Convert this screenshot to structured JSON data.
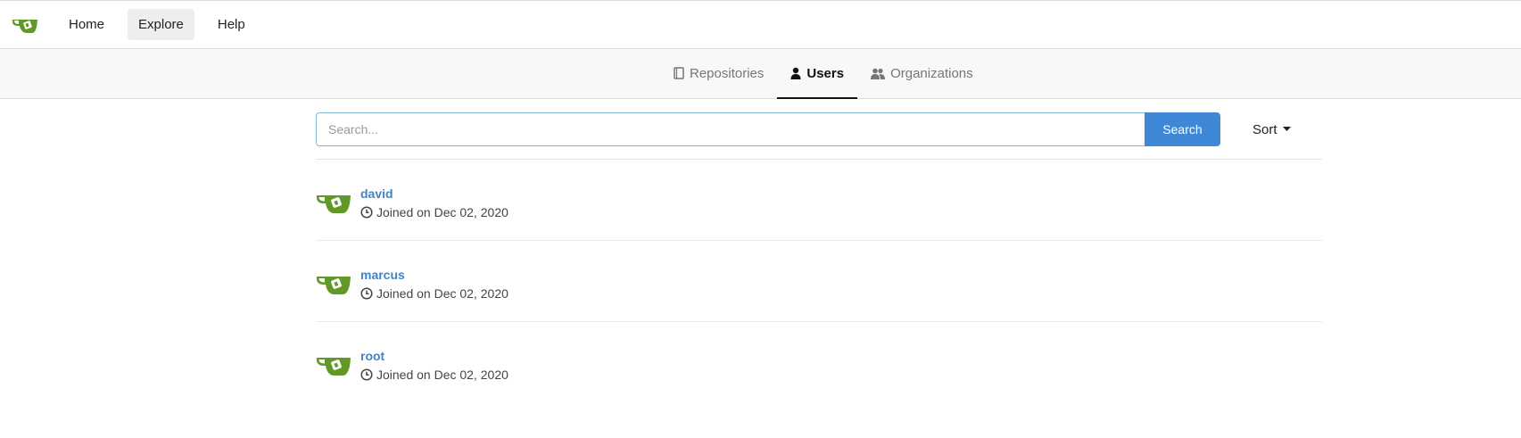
{
  "nav": {
    "logo_icon": "gitea-teacup-icon",
    "items": [
      {
        "label": "Home",
        "active": false
      },
      {
        "label": "Explore",
        "active": true
      },
      {
        "label": "Help",
        "active": false
      }
    ]
  },
  "tabs": [
    {
      "label": "Repositories",
      "icon": "book-icon",
      "active": false
    },
    {
      "label": "Users",
      "icon": "person-icon",
      "active": true
    },
    {
      "label": "Organizations",
      "icon": "people-icon",
      "active": false
    }
  ],
  "search": {
    "placeholder": "Search...",
    "value": "",
    "button_label": "Search",
    "sort_label": "Sort"
  },
  "users": [
    {
      "name": "david",
      "joined": "Joined on Dec 02, 2020"
    },
    {
      "name": "marcus",
      "joined": "Joined on Dec 02, 2020"
    },
    {
      "name": "root",
      "joined": "Joined on Dec 02, 2020"
    }
  ],
  "colors": {
    "accent": "#3f88d7",
    "link": "#4183c4",
    "logo_green": "#609926"
  }
}
